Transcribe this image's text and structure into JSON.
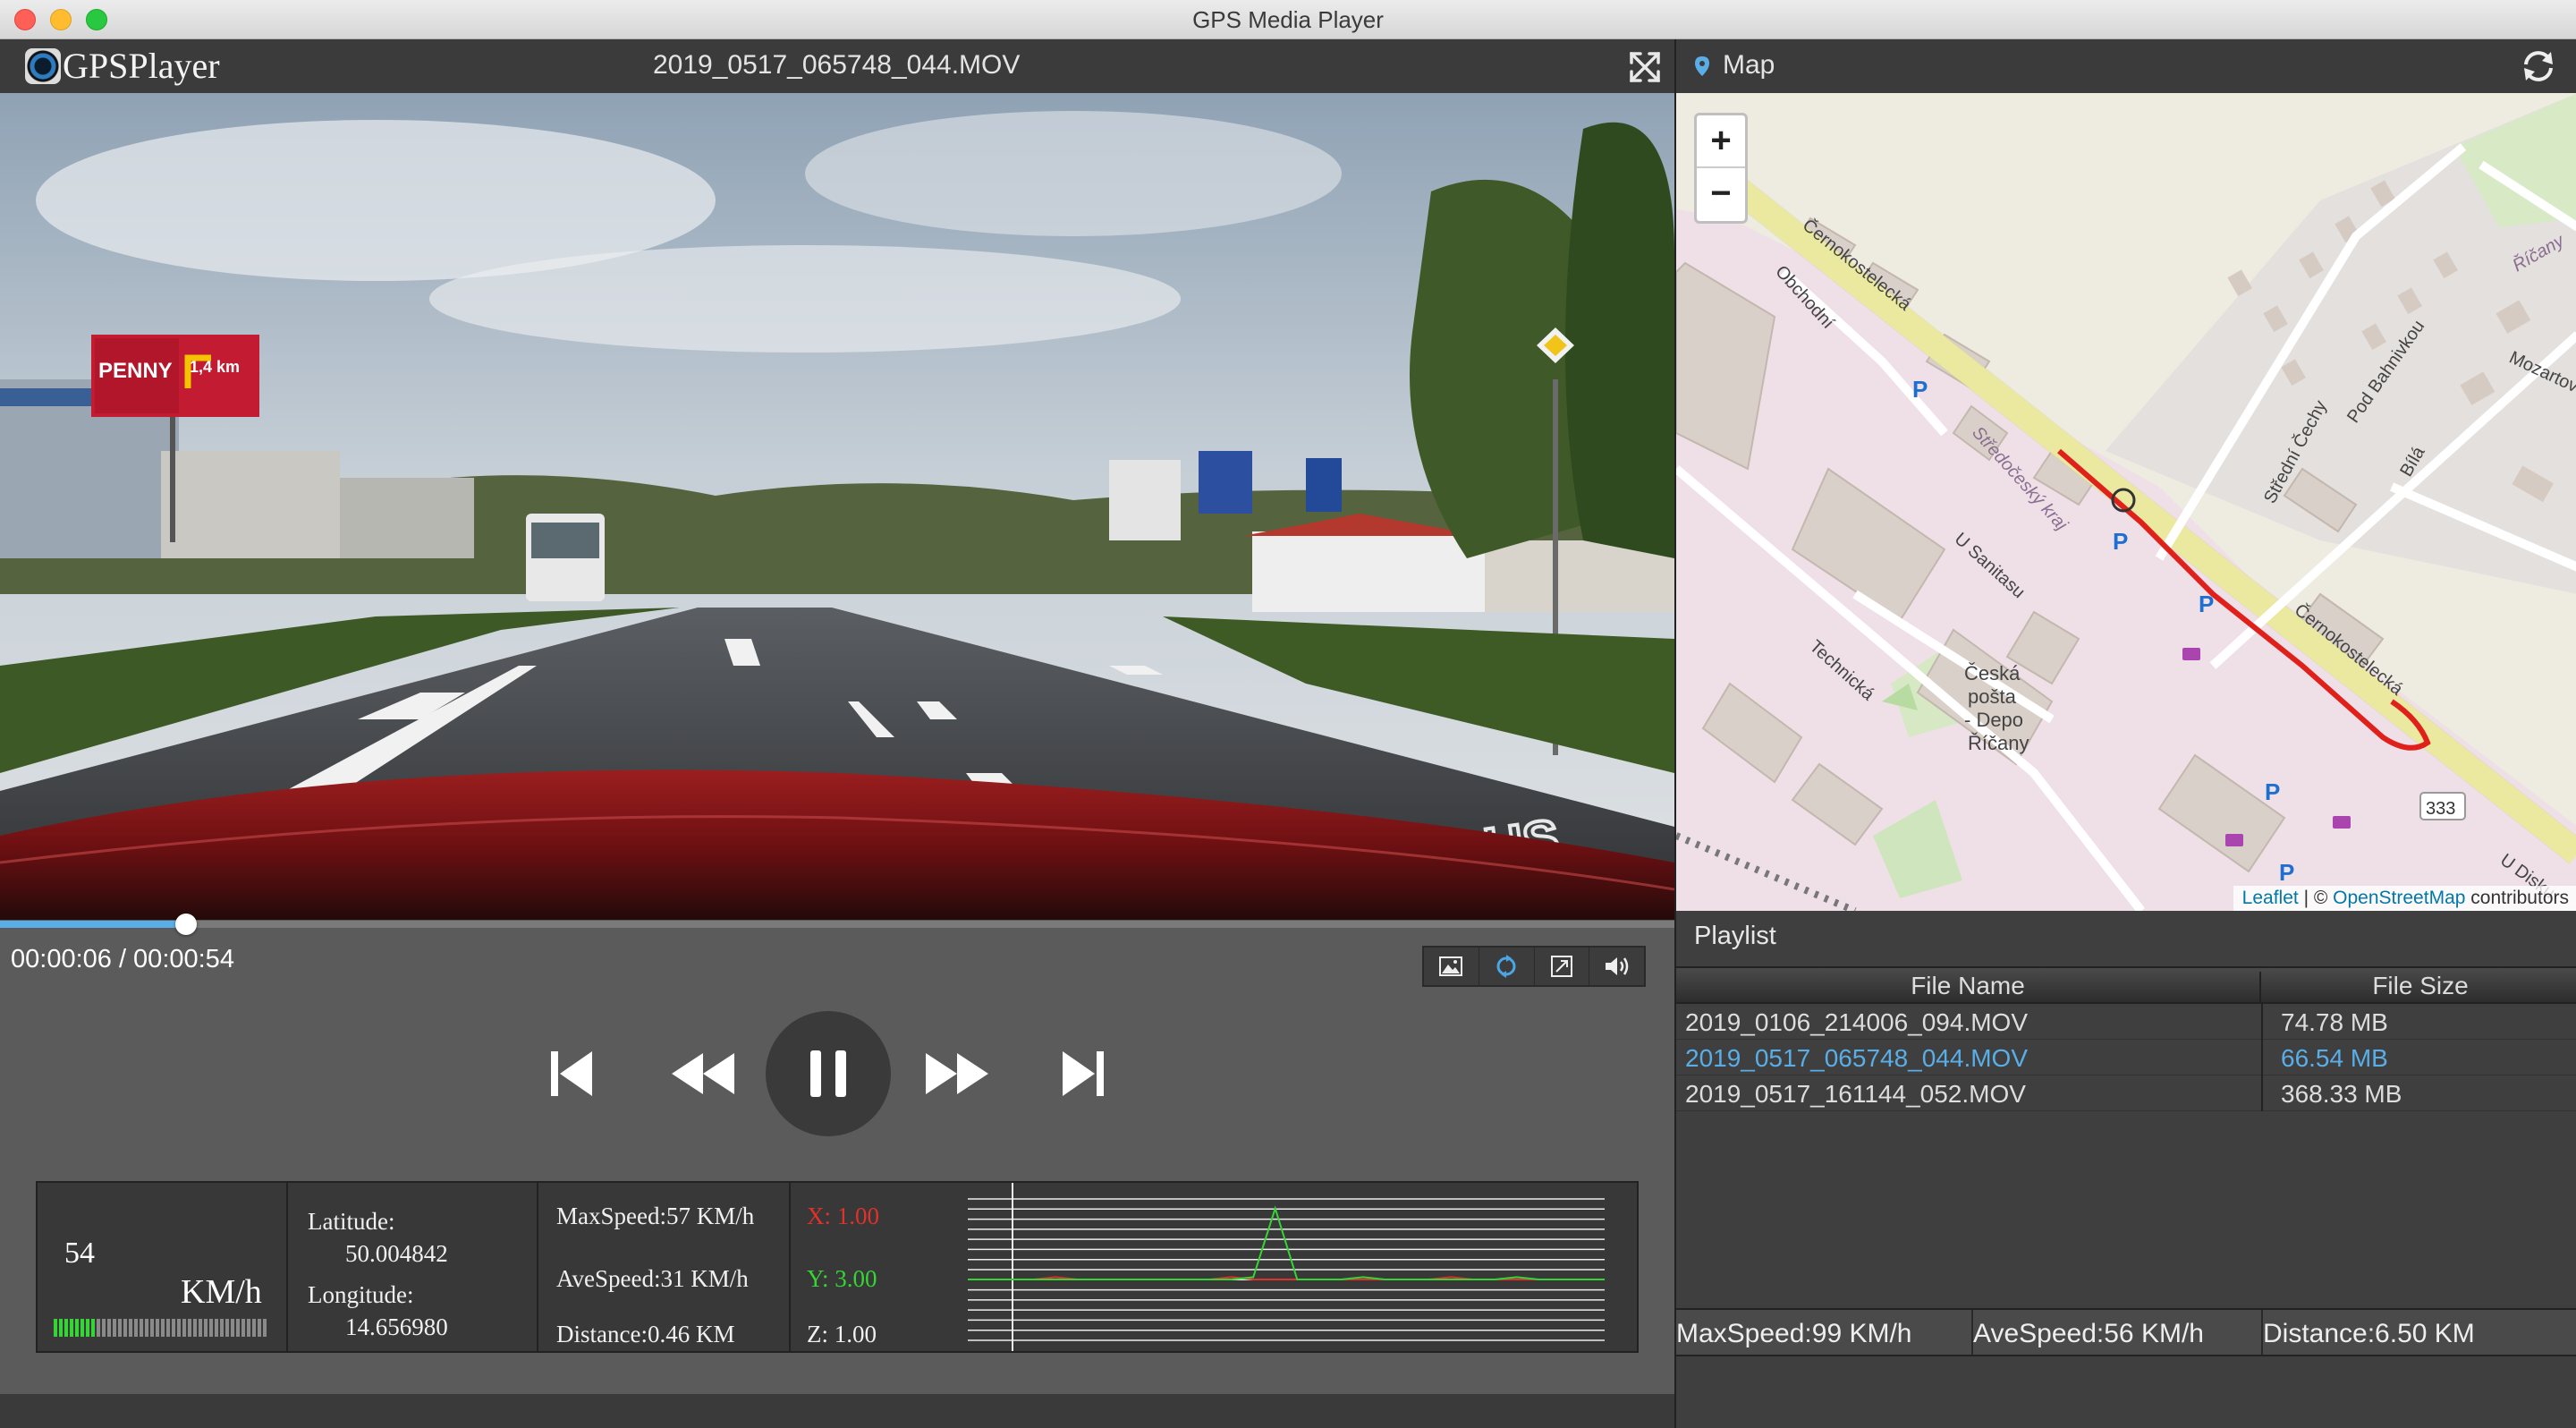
{
  "window": {
    "title": "GPS Media Player"
  },
  "player": {
    "app_name": "GPSPlayer",
    "filename": "2019_0517_065748_044.MOV",
    "time": "00:00:06 / 00:00:54",
    "progress_fraction": 0.111
  },
  "video_scene": {
    "billboard_left_brand": "PENNY",
    "billboard_left_distance": "1,4 km",
    "road_marking": "BUS"
  },
  "view_tools": [
    {
      "name": "snapshot",
      "icon": "image-icon"
    },
    {
      "name": "rotate",
      "icon": "rotate-icon"
    },
    {
      "name": "fit",
      "icon": "fit-screen-icon"
    },
    {
      "name": "volume",
      "icon": "volume-icon"
    }
  ],
  "dashboard": {
    "speed": "54",
    "speed_unit": "KM/h",
    "speed_meter_level": 0.2,
    "latitude_label": "Latitude:",
    "latitude": "50.004842",
    "longitude_label": "Longitude:",
    "longitude": "14.656980",
    "max_speed": "MaxSpeed:57 KM/h",
    "ave_speed": "AveSpeed:31 KM/h",
    "distance": "Distance:0.46 KM",
    "accel_x": "X: 1.00",
    "accel_y": "Y: 3.00",
    "accel_z": "Z: 1.00",
    "colors": {
      "x": "#e0312b",
      "y": "#34d534",
      "z": "#f0f0f0"
    }
  },
  "chart_data": {
    "type": "line",
    "title": "",
    "series": [
      {
        "name": "X",
        "color": "#e0312b",
        "values": [
          0,
          0,
          0,
          0,
          0.1,
          0,
          0,
          0,
          0,
          0,
          0,
          0,
          0.1,
          0,
          0,
          0,
          0,
          0,
          0,
          0,
          0,
          0,
          0.1,
          0,
          0,
          0,
          0,
          0,
          0,
          0
        ]
      },
      {
        "name": "Y",
        "color": "#34d534",
        "values": [
          0,
          0,
          0,
          0,
          0,
          0,
          0,
          0,
          0,
          0,
          0,
          0,
          0,
          0.1,
          3.0,
          0,
          0,
          0,
          0.1,
          0,
          0,
          0,
          0,
          0,
          0,
          0.1,
          0,
          0,
          0,
          0
        ]
      }
    ],
    "ylim": [
      -0.2,
      3.2
    ]
  },
  "map": {
    "title": "Map",
    "zoom_in": "+",
    "zoom_out": "−",
    "attribution_leaflet": "Leaflet",
    "attribution_sep": " | © ",
    "attribution_osm": "OpenStreetMap",
    "attribution_tail": " contributors",
    "labels": {
      "cernokostelecka": "Černokostelecká",
      "obchodni": "Obchodní",
      "stredocesky": "Středočeský kraj",
      "u_sanitasu": "U Sanitasu",
      "technicka": "Technická",
      "posta_1": "Česká",
      "posta_2": "pošta",
      "posta_3": "- Depo",
      "posta_4": "Říčany",
      "pod_bahnivkou": "Pod Bahnivkou",
      "stredni_cechy": "Střední Čechy",
      "bila": "Bílá",
      "ricany": "Říčany",
      "mozartova": "Mozartova",
      "road_333": "333",
      "u_disku": "U Disku",
      "parking": "P"
    },
    "route_color": "#e0201a"
  },
  "playlist": {
    "title": "Playlist",
    "col_name": "File Name",
    "col_size": "File Size",
    "rows": [
      {
        "name": "2019_0106_214006_094.MOV",
        "size": "74.78 MB",
        "active": false
      },
      {
        "name": "2019_0517_065748_044.MOV",
        "size": "66.54 MB",
        "active": true
      },
      {
        "name": "2019_0517_161144_052.MOV",
        "size": "368.33 MB",
        "active": false
      }
    ],
    "active_color": "#5aaee8"
  },
  "totals": {
    "max_speed": "MaxSpeed:99 KM/h",
    "ave_speed": "AveSpeed:56 KM/h",
    "distance": "Distance:6.50 KM"
  }
}
